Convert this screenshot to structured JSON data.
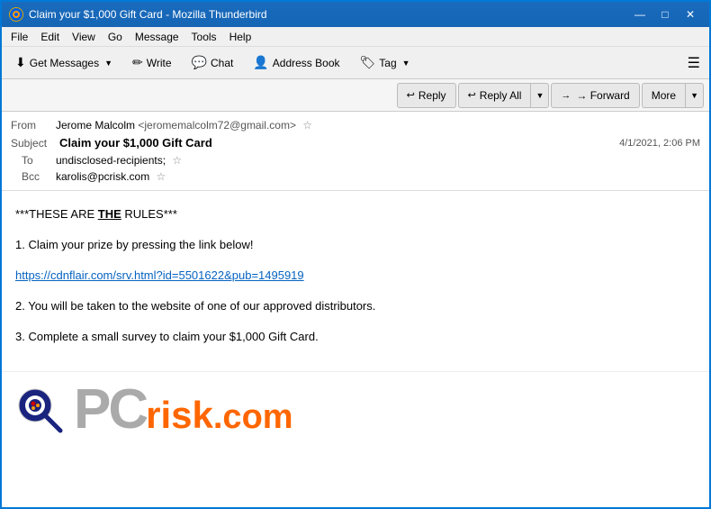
{
  "window": {
    "title": "Claim your $1,000 Gift Card - Mozilla Thunderbird",
    "icon": "T"
  },
  "title_controls": {
    "minimize": "—",
    "maximize": "□",
    "close": "✕"
  },
  "menu": {
    "items": [
      "File",
      "Edit",
      "View",
      "Go",
      "Message",
      "Tools",
      "Help"
    ]
  },
  "toolbar": {
    "get_messages": "Get Messages",
    "write": "Write",
    "chat": "Chat",
    "address_book": "Address Book",
    "tag": "Tag",
    "hamburger": "☰"
  },
  "action_toolbar": {
    "reply": "Reply",
    "reply_all": "Reply All",
    "forward": "→ Forward",
    "more": "More"
  },
  "email": {
    "from_label": "From",
    "from_name": "Jerome Malcolm",
    "from_email": "<jeromemalcolm72@gmail.com>",
    "subject_label": "Subject",
    "subject": "Claim your $1,000 Gift Card",
    "date": "4/1/2021, 2:06 PM",
    "to_label": "To",
    "to_value": "undisclosed-recipients;",
    "bcc_label": "Bcc",
    "bcc_value": "karolis@pcrisk.com"
  },
  "body": {
    "line1": "***THESE ARE THE RULES***",
    "line1_bold": "THE",
    "step1": "1. Claim your prize by pressing the link below!",
    "link": "https://cdnflair.com/srv.html?id=5501622&pub=1495919",
    "step2": "2. You will be taken to the website of one of our approved distributors.",
    "step3": "3. Complete a small survey to claim your $1,000 Gift Card."
  },
  "logo": {
    "pc_text": "PC",
    "risk_text": "risk",
    "dot_com": ".com"
  }
}
